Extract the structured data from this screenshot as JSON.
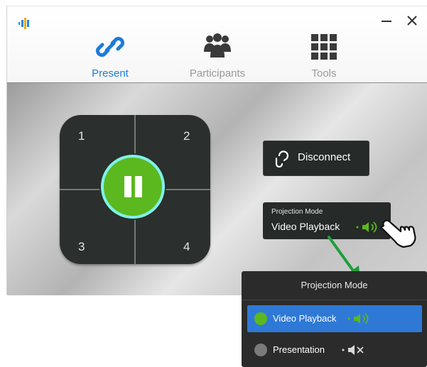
{
  "tabs": [
    {
      "label": "Present",
      "icon": "link-icon",
      "active": true
    },
    {
      "label": "Participants",
      "icon": "users-icon",
      "active": false
    },
    {
      "label": "Tools",
      "icon": "grid-icon",
      "active": false
    }
  ],
  "window_controls": {
    "minimize": "—",
    "close": "✕"
  },
  "quadrants": [
    "1",
    "2",
    "3",
    "4"
  ],
  "disconnect_label": "Disconnect",
  "projection_mode": {
    "title": "Projection Mode",
    "value": "Video Playback"
  },
  "dropdown": {
    "title": "Projection Mode",
    "options": [
      {
        "label": "Video Playback",
        "selected": true,
        "audio": "on"
      },
      {
        "label": "Presentation",
        "selected": false,
        "audio": "muted"
      }
    ]
  },
  "colors": {
    "accent_blue": "#1e7bd9",
    "play_green": "#5cb81f",
    "ring_cyan": "#7ff0ea",
    "dark_panel": "#262a28",
    "selected_option": "#2f79d6"
  }
}
